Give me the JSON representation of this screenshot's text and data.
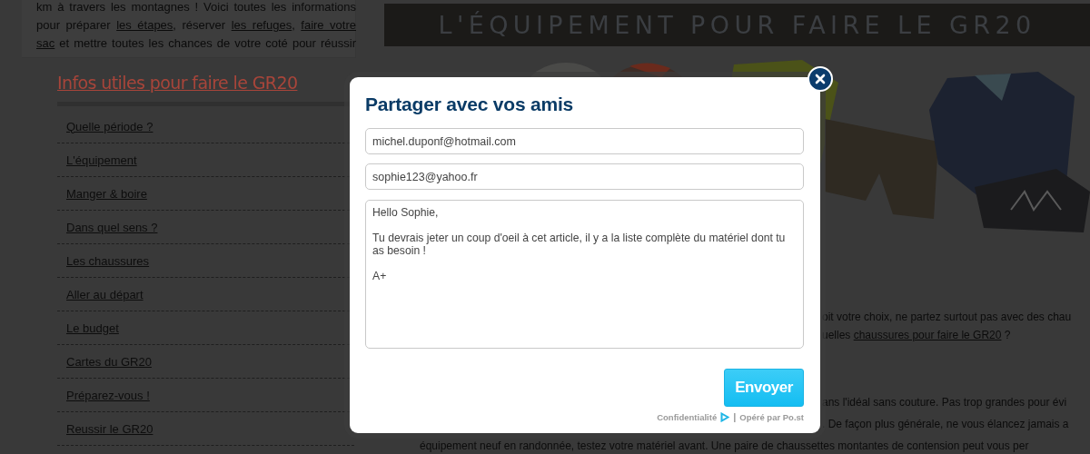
{
  "intro": [
    [
      {
        "text": "km à travers les montagnes ! Voici toutes les informations",
        "link": false
      }
    ],
    [
      {
        "text": "pour préparer ",
        "link": false
      },
      {
        "text": "les étapes",
        "link": true
      },
      {
        "text": ", réserver ",
        "link": false
      },
      {
        "text": "les refuges",
        "link": true
      },
      {
        "text": ", ",
        "link": false
      },
      {
        "text": "faire votre",
        "link": true
      }
    ],
    [
      {
        "text": "sac",
        "link": true
      },
      {
        "text": " et mettre toutes les chances de votre coté pour réussir",
        "link": false
      }
    ]
  ],
  "sidebar": {
    "title": "Infos utiles pour faire le GR20",
    "items": [
      "Quelle période ?",
      "L'équipement",
      "Manger & boire",
      "Dans quel sens ?",
      "Les chaussures",
      "Aller au départ",
      "Le budget",
      "Cartes du GR20",
      "Préparez-vous !",
      "Reussir le GR20"
    ]
  },
  "banner": {
    "title": "L'ÉQUIPEMENT POUR FAIRE LE GR20"
  },
  "hero": {
    "kind": "picture"
  },
  "body": [
    {
      "lines": [
        {
          "kind": "partial",
          "segments": [
            {
              "text": "oit votre choix, ne partez surtout pas avec des chau",
              "link": false
            }
          ]
        },
        {
          "kind": "partial",
          "segments": [
            {
              "text": "uelles ",
              "link": false
            },
            {
              "text": "chaussures pour faire le GR20",
              "link": true
            },
            {
              "text": " ?",
              "link": false
            }
          ]
        }
      ]
    },
    {
      "lines": [
        {
          "kind": "partial",
          "segments": [
            {
              "text": "ans l'idéal sans couture. Pas trop grandes pour évi",
              "link": false
            }
          ]
        },
        {
          "kind": "partial",
          "segments": [
            {
              "text": ". De façon plus générale, ne vous élancez jamais a",
              "link": false
            }
          ]
        },
        {
          "kind": "full",
          "segments": [
            {
              "text": "équipement neuf en randonnée, testez votre matériel avant. Une paire de chaussettes montantes de contension peut vous per",
              "link": false
            }
          ]
        }
      ]
    }
  ],
  "dialog": {
    "title": "Partager avec vos amis",
    "from": "michel.duponf@hotmail.com",
    "to": "sophie123@yahoo.fr",
    "message": "Hello Sophie,\n\nTu devrais jeter un coup d'oeil à cet article, il y a la liste complète du matériel dont tu as besoin !\n\nA+",
    "send": "Envoyer",
    "privacy": "Confidentialité",
    "separator": "|",
    "operated": "Opéré par Po.st"
  }
}
